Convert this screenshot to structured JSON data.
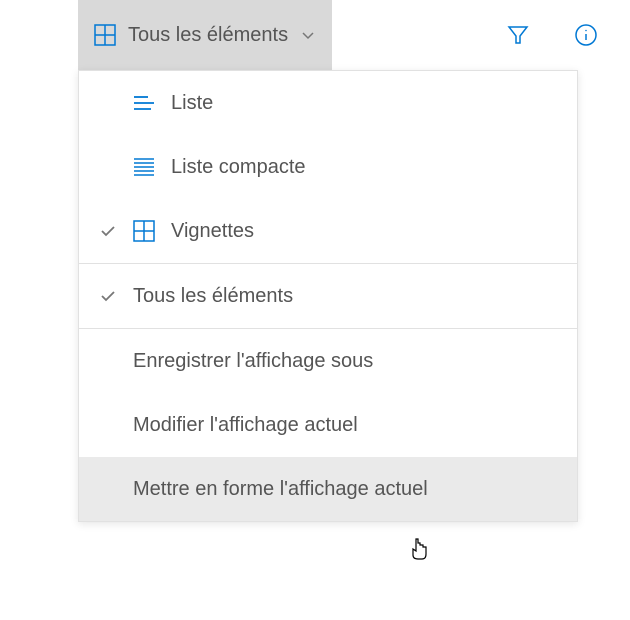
{
  "toolbar": {
    "viewSelector": {
      "label": "Tous les éléments"
    }
  },
  "menu": {
    "items": [
      {
        "label": "Liste",
        "icon": "list-icon",
        "checked": false
      },
      {
        "label": "Liste compacte",
        "icon": "compact-list-icon",
        "checked": false
      },
      {
        "label": "Vignettes",
        "icon": "tiles-icon",
        "checked": true
      }
    ],
    "views": [
      {
        "label": "Tous les éléments",
        "checked": true
      }
    ],
    "actions": [
      {
        "label": "Enregistrer l'affichage sous"
      },
      {
        "label": "Modifier l'affichage actuel"
      },
      {
        "label": "Mettre en forme l'affichage actuel"
      }
    ]
  },
  "colors": {
    "accent": "#0078d4",
    "text": "#555555",
    "hover": "#eaeaea",
    "active": "#d9d9d9"
  }
}
